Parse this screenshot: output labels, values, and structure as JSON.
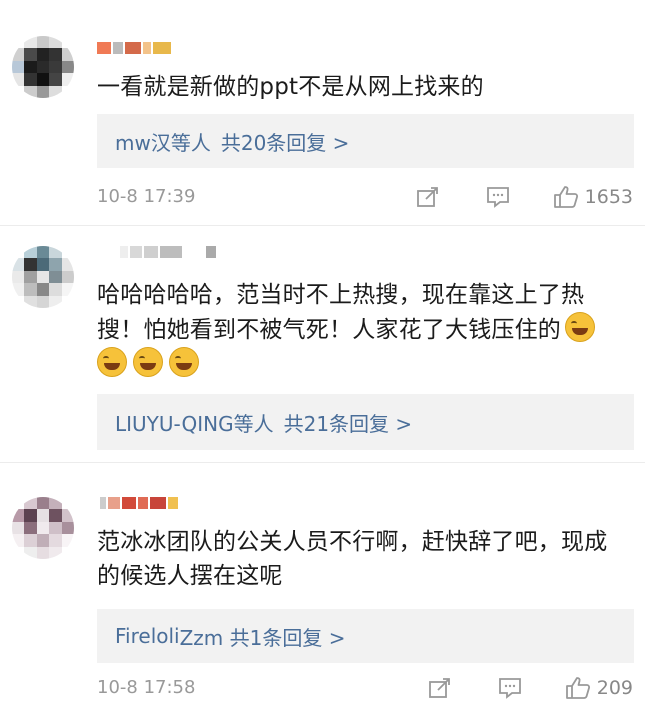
{
  "comments": [
    {
      "text": "一看就是新做的ppt不是从网上找来的",
      "reply_names": "mw汉等人",
      "reply_count": "共20条回复 >",
      "time": "10-8 17:39",
      "likes": "1653"
    },
    {
      "text": "哈哈哈哈哈，范当时不上热搜，现在靠这上了热搜！怕她看到不被气死！人家花了大钱压住的",
      "reply_names": "LIUYU-QING等人",
      "reply_count": "共21条回复 >",
      "emoji": "laugh-cry"
    },
    {
      "text": "范冰冰团队的公关人员不行啊，赶快辞了吧，现成的候选人摆在这呢",
      "reply_names": "Fireloli",
      "reply_count": "Zzm 共1条回复 >",
      "time": "10-8 17:58",
      "likes": "209"
    }
  ],
  "icons": {
    "share": "share-icon",
    "comment": "comment-icon",
    "like": "thumbs-up-icon"
  },
  "colors": {
    "link": "#4a6e99",
    "meta": "#999999",
    "reply_bg": "#f2f2f2"
  }
}
